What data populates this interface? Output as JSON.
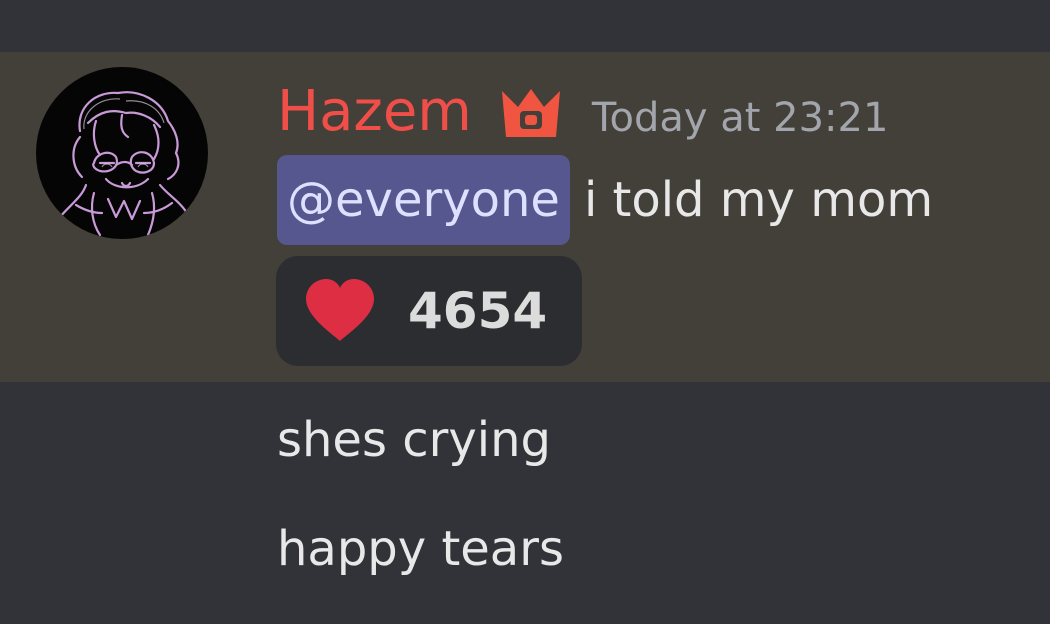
{
  "message": {
    "author": "Hazem",
    "author_color": "#f04e49",
    "badge_icon": "crown-icon",
    "timestamp": "Today at 23:21",
    "mention": "@everyone",
    "text": " i told my mom",
    "reaction": {
      "emoji_icon": "heart-icon",
      "count": "4654"
    }
  },
  "followups": [
    {
      "text": "shes crying"
    },
    {
      "text": "happy tears"
    }
  ],
  "colors": {
    "background": "#313338",
    "highlight_background": "#433f39",
    "mention_background": "#55578e",
    "reaction_background": "#2c2d31"
  }
}
